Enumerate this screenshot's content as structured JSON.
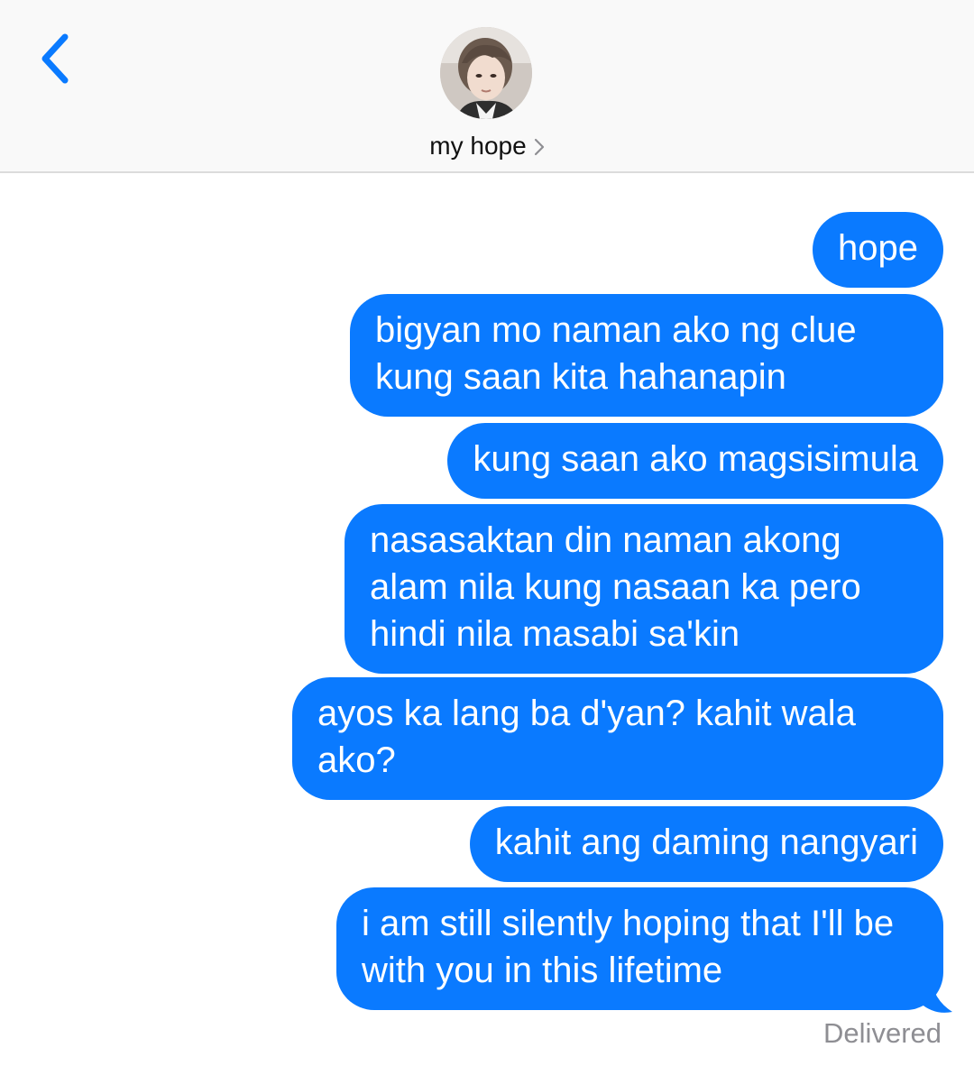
{
  "header": {
    "back_icon": "chevron-left-icon",
    "contact_name": "my hope",
    "contact_chevron_icon": "chevron-right-icon",
    "accent_color": "#0a7aff"
  },
  "messages": [
    {
      "text": "hope",
      "direction": "outgoing"
    },
    {
      "text": "bigyan mo naman ako ng clue kung saan kita hahanapin",
      "direction": "outgoing"
    },
    {
      "text": "kung saan ako magsisimula",
      "direction": "outgoing"
    },
    {
      "text": "nasasaktan din naman akong alam nila kung nasaan ka pero hindi nila masabi sa'kin",
      "direction": "outgoing"
    },
    {
      "text": "ayos ka lang ba d'yan? kahit wala ako?",
      "direction": "outgoing"
    },
    {
      "text": "kahit ang daming nangyari",
      "direction": "outgoing"
    },
    {
      "text": "i am still silently hoping that I'll be with you in this lifetime",
      "direction": "outgoing"
    }
  ],
  "status": "Delivered"
}
